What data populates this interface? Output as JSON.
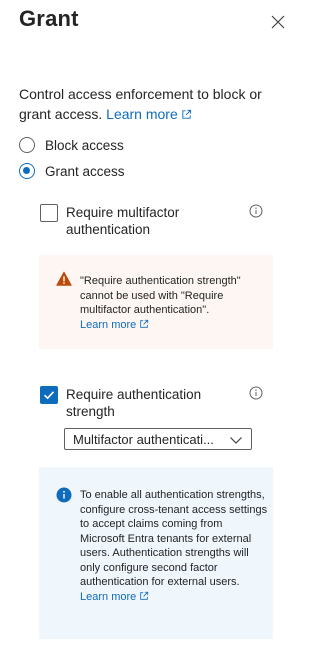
{
  "panel": {
    "title": "Grant",
    "close_icon": "close-icon"
  },
  "intro": {
    "text": "Control access enforcement to block or grant access.",
    "learn_more": "Learn more"
  },
  "options": {
    "block_label": "Block access",
    "grant_label": "Grant access",
    "selected": "grant"
  },
  "controls": {
    "mfa": {
      "label": "Require multifactor authentication",
      "checked": false
    },
    "warning": {
      "text": "\"Require authentication strength\" cannot be used with \"Require multifactor authentication\".",
      "learn_more": "Learn more"
    },
    "auth_strength": {
      "label": "Require authentication strength",
      "checked": true,
      "dropdown_value": "Multifactor authenticati..."
    },
    "info": {
      "text": "To enable all authentication strengths, configure cross-tenant access settings to accept claims coming from Microsoft Entra tenants for external users. Authentication strengths will only configure second factor authentication for external users.",
      "learn_more": "Learn more"
    }
  },
  "colors": {
    "accent": "#0f6cbd",
    "warning_bg": "#fdf6f3",
    "warning_icon": "#bc4b09",
    "info_bg": "#eff6fc"
  }
}
